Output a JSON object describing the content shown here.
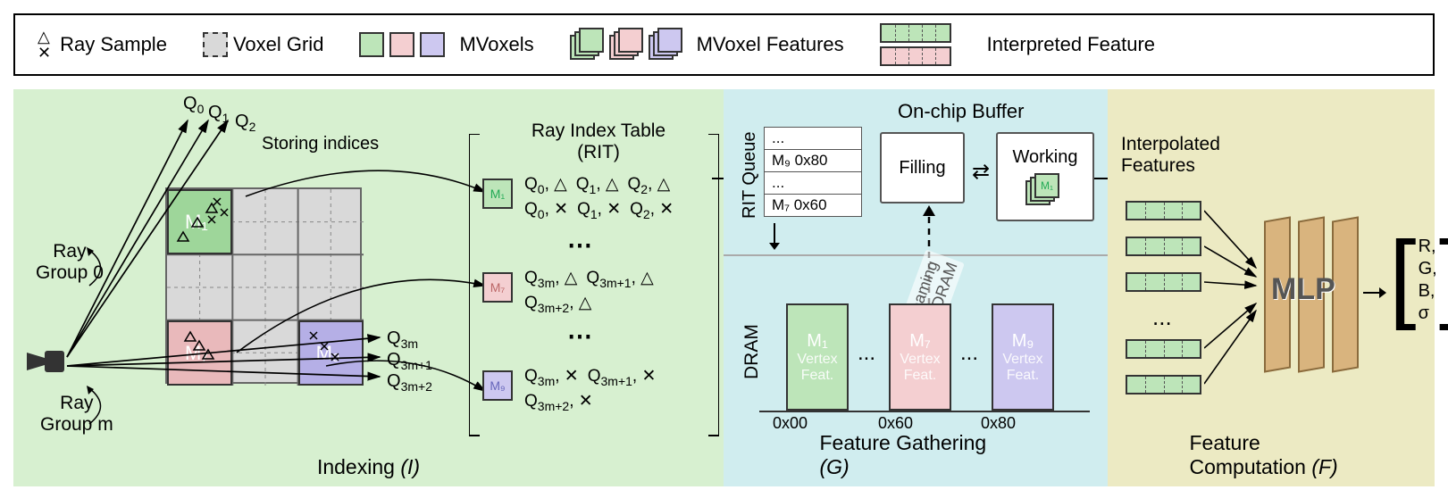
{
  "legend": {
    "ray_sample": "Ray Sample",
    "voxel_grid": "Voxel Grid",
    "mvoxels": "MVoxels",
    "mvoxel_features": "MVoxel Features",
    "interpreted_feature": "Interpreted Feature"
  },
  "indexing": {
    "panel_label": "Indexing  ",
    "panel_symbol": "(I)",
    "rays": {
      "Q0": "Q",
      "Q0s": "0",
      "Q1": "Q",
      "Q1s": "1",
      "Q2": "Q",
      "Q2s": "2"
    },
    "storing_indices": "Storing indices",
    "rit_title": "Ray Index Table\n(RIT)",
    "ray_group_0": "Ray\nGroup 0",
    "ray_group_m": "Ray\nGroup m",
    "q3m": "Q",
    "q3m_s": "3m",
    "q3m1": "Q",
    "q3m1_s": "3m+1",
    "q3m2": "Q",
    "q3m2_s": "3m+2",
    "chips": {
      "M1": "M₁",
      "M7": "M₇",
      "M9": "M₉"
    },
    "rit_rows": {
      "r1a": [
        "Q",
        "0",
        " △ ",
        "Q",
        "1",
        " △ ",
        "Q",
        "2",
        " △"
      ],
      "r1b": [
        "Q",
        "0",
        " ✕ ",
        "Q",
        "1",
        " ✕ ",
        "Q",
        "2",
        " ✕"
      ],
      "r2a": [
        "Q",
        "3m",
        " △ ",
        "Q",
        "3m+1",
        " △"
      ],
      "r2b": [
        "Q",
        "3m+2",
        " △"
      ],
      "r3a": [
        "Q",
        "3m",
        " ✕ ",
        "Q",
        "3m+1",
        " ✕"
      ],
      "r3b": [
        "Q",
        "3m+2",
        " ✕"
      ]
    }
  },
  "gathering": {
    "panel_label": "Feature Gathering ",
    "panel_symbol": "(G)",
    "on_chip": "On-chip Buffer",
    "rit_queue": "RIT Queue",
    "dram": "DRAM",
    "filling": "Filling",
    "working": "Working",
    "streaming": "Streaming\nfrom DRAM",
    "queue_rows": [
      "...",
      "M₉  0x80",
      "...",
      "M₇  0x60"
    ],
    "dram_blocks": [
      {
        "name": "M₁",
        "sub": "Vertex\nFeat."
      },
      {
        "name": "M₇",
        "sub": "Vertex\nFeat."
      },
      {
        "name": "M₉",
        "sub": "Vertex\nFeat."
      }
    ],
    "ellipsis": "...",
    "addrs": [
      "0x00",
      "0x60",
      "0x80"
    ]
  },
  "computation": {
    "panel_label": "Feature Computation ",
    "panel_symbol": "(F)",
    "interp_feat": "Interpolated\nFeatures",
    "mlp": "MLP",
    "ellipsis": "...",
    "output": [
      "R,",
      "G,",
      "B,",
      "σ"
    ]
  }
}
